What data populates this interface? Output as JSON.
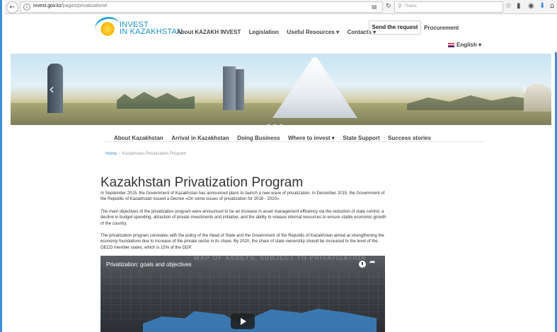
{
  "browser": {
    "url_host": "invest.gov.kz",
    "url_path": "/pages/privatization#",
    "search_placeholder": "Поиск",
    "icons": [
      "back-arrow-icon",
      "info-icon",
      "reader-view-icon",
      "reload-icon",
      "search-icon",
      "bookmark-star-icon",
      "library-icon",
      "pocket-icon",
      "download-icon",
      "home-icon"
    ]
  },
  "header": {
    "logo_line1": "INVEST",
    "logo_line2": "IN KAZAKHSTAN",
    "nav": [
      "About KAZAKH INVEST",
      "Legislation",
      "Useful Resources ▾",
      "Contacts ▾"
    ],
    "send_request": "Send the request",
    "procurement": "Procurement",
    "language": "English ▾"
  },
  "banner": {
    "prev": "‹",
    "next": "›",
    "slides": 3,
    "active_slide": 1
  },
  "subnav": [
    "About Kazakhstan",
    "Arrival in Kazakhstan",
    "Doing Business",
    "Where to invest ▾",
    "State Support",
    "Success stories"
  ],
  "breadcrumb": {
    "home": "Home",
    "separator": "/",
    "current": "Kazakhstan Privatization Program"
  },
  "main": {
    "title": "Kazakhstan Privatization Program",
    "paragraphs": [
      "In September 2015, the Government of Kazakhstan has announced plans to launch a new wave of privatization. In December 2015, the Government of the Republic of Kazakhstan issued a Decree «On some issues of privatization for 2016 - 2020».",
      "The main objectives of the privatization program were announced to be an increase in asset management efficiency via the reduction of state control, a decline in budget spending, attraction of private investments and initiative, and the ability to release internal resources to ensure stable economic growth of the country.",
      "The privatization program correlates with the policy of the Head of State and the Government of the Republic of Kazakhstan aimed at strengthening the economy foundations due to increase of the private sector in its share. By 2020, the share of state ownership should be increased to the level of the OECD member states, which is 15% of the GDP."
    ]
  },
  "video": {
    "title": "Privatization: goals and objectives",
    "background_text": "MAP OF ASSETS, SUBJECT TO PRIVATIZATION"
  },
  "colors": {
    "accent": "#3b8fd9",
    "logo_blue": "#1c8fc8",
    "logo_yellow": "#f5b700",
    "text": "#333333"
  }
}
